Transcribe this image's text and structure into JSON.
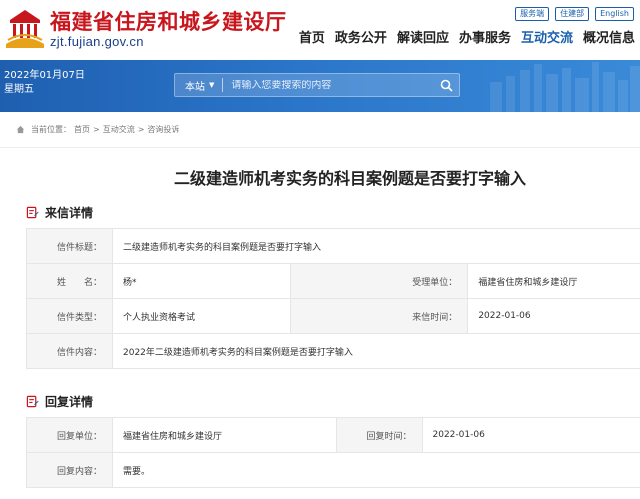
{
  "header": {
    "site_name": "福建省住房和城乡建设厅",
    "site_url": "zjt.fujian.gov.cn",
    "utility_links": [
      "服务端",
      "住建部",
      "English"
    ],
    "nav": [
      {
        "label": "首页",
        "active": false
      },
      {
        "label": "政务公开",
        "active": false
      },
      {
        "label": "解读回应",
        "active": false
      },
      {
        "label": "办事服务",
        "active": false
      },
      {
        "label": "互动交流",
        "active": true
      },
      {
        "label": "概况信息",
        "active": false
      }
    ]
  },
  "banner": {
    "date": "2022年01月07日",
    "weekday": "星期五",
    "search": {
      "scope": "本站",
      "placeholder": "请输入您要搜索的内容"
    }
  },
  "breadcrumb": {
    "prefix": "当前位置：",
    "items": [
      "首页",
      "互动交流",
      "咨询投诉"
    ],
    "separator": ">"
  },
  "page_title": "二级建造师机考实务的科目案例题是否要打字输入",
  "letter_section": {
    "heading": "来信详情",
    "subject_label": "信件标题：",
    "subject": "二级建造师机考实务的科目案例题是否要打字输入",
    "name_label": "姓　　名：",
    "name": "杨*",
    "dept_label": "受理单位：",
    "dept": "福建省住房和城乡建设厅",
    "type_label": "信件类型：",
    "type": "个人执业资格考试",
    "time_label": "来信时间：",
    "time": "2022-01-06",
    "content_label": "信件内容：",
    "content": "2022年二级建造师机考实务的科目案例题是否要打字输入"
  },
  "reply_section": {
    "heading": "回复详情",
    "unit_label": "回复单位：",
    "unit": "福建省住房和城乡建设厅",
    "time_label": "回复时间：",
    "time": "2022-01-06",
    "content_label": "回复内容：",
    "content": "需要。"
  },
  "colors": {
    "brand_red": "#c8161d",
    "brand_blue": "#1a5fae",
    "banner_blue": "#2a75c9"
  }
}
